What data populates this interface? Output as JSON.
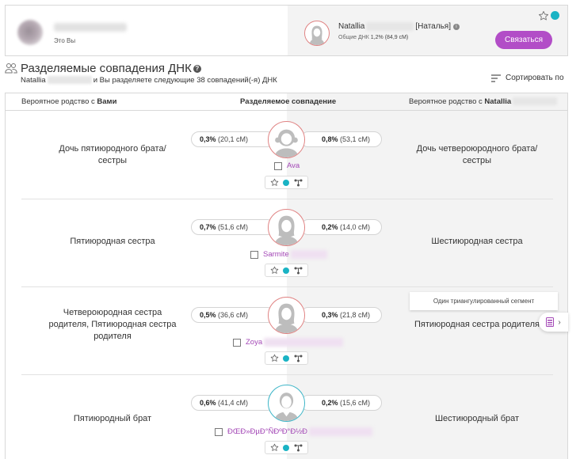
{
  "header": {
    "me_label": "Это Вы",
    "match_name": "Natallia",
    "match_alias": "[Наталья]",
    "shared_dna_label": "Общие ДНК",
    "shared_dna_value": "1,2% (84,9 сМ)",
    "contact_button": "Связаться"
  },
  "section": {
    "title": "Разделяемые совпадения ДНК",
    "subtitle_name": "Natallia",
    "subtitle_text": "и Вы разделяете следующие 38 совпадений(-я) ДНК",
    "sort_label": "Сортировать по"
  },
  "table": {
    "col_left_prefix": "Вероятное родство с",
    "col_left_bold": "Вами",
    "col_mid": "Разделяемое совпадение",
    "col_right_prefix": "Вероятное родство с",
    "col_right_name": "Natallia"
  },
  "rows": [
    {
      "rel_left": "Дочь пятиюродного брата/сестры",
      "left_pct": "0,3%",
      "left_cm": "(20,1 сМ)",
      "right_pct": "0,8%",
      "right_cm": "(53,1 сМ)",
      "name": "Ava",
      "gender": "female",
      "rel_right": "Дочь четвероюродного брата/сестры"
    },
    {
      "rel_left": "Пятиюродная сестра",
      "left_pct": "0,7%",
      "left_cm": "(51,6 сМ)",
      "right_pct": "0,2%",
      "right_cm": "(14,0 сМ)",
      "name": "Sarmite",
      "gender": "female",
      "rel_right": "Шестиюродная сестра"
    },
    {
      "rel_left": "Четвероюродная сестра родителя, Пятиюродная сестра родителя",
      "left_pct": "0,5%",
      "left_cm": "(36,6 сМ)",
      "right_pct": "0,3%",
      "right_cm": "(21,8 сМ)",
      "name": "Zoya",
      "gender": "female",
      "rel_right": "Пятиюродная сестра родителя"
    },
    {
      "rel_left": "Пятиюродный брат",
      "left_pct": "0,6%",
      "left_cm": "(41,4 сМ)",
      "right_pct": "0,2%",
      "right_cm": "(15,6 сМ)",
      "name": "ÐŒÐ»ÐµÐ°ÑÐºÐ°Ð½Ð",
      "gender": "male",
      "rel_right": "Шестиюродный брат"
    }
  ],
  "tooltip": "Один триангулированный сегмент",
  "colors": {
    "accent_purple": "#b24dc7",
    "match_name": "#a347b6",
    "teal": "#1ab3c4",
    "female_border": "#e08383",
    "male_border": "#3fb6c8"
  }
}
